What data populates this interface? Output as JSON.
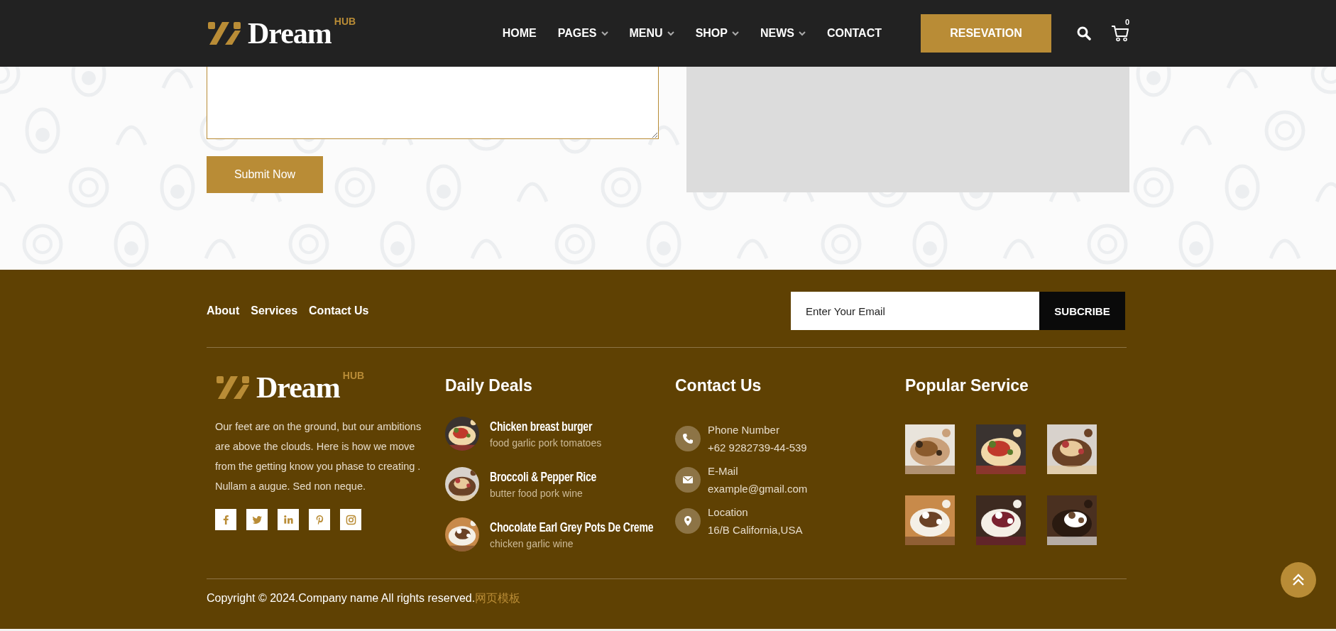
{
  "header": {
    "logo": {
      "word": "Dream",
      "badge": "HUB"
    },
    "nav": [
      {
        "label": "HOME",
        "dropdown": false
      },
      {
        "label": "PAGES",
        "dropdown": true
      },
      {
        "label": "MENU",
        "dropdown": true
      },
      {
        "label": "SHOP",
        "dropdown": true
      },
      {
        "label": "NEWS",
        "dropdown": true
      },
      {
        "label": "CONTACT",
        "dropdown": false
      }
    ],
    "reservation_button": "RESEVATION",
    "cart_count": "0"
  },
  "form": {
    "submit_label": "Submit Now"
  },
  "footer": {
    "links": [
      "About",
      "Services",
      "Contact Us"
    ],
    "newsletter": {
      "placeholder": "Enter Your Email",
      "button": "SUBCRIBE"
    },
    "about": {
      "logo": {
        "word": "Dream",
        "badge": "HUB"
      },
      "text": "Our feet are on the ground, but our ambitions are above the clouds. Here is how we move from the getting know you phase to creating . Nullam a augue. Sed non neque.",
      "social": [
        {
          "kind": "facebook"
        },
        {
          "kind": "twitter"
        },
        {
          "kind": "linkedin"
        },
        {
          "kind": "pinterest"
        },
        {
          "kind": "instagram"
        }
      ]
    },
    "daily_deals": {
      "title": "Daily Deals",
      "items": [
        {
          "kind": "picture",
          "title": "Chicken breast burger",
          "subtitle": "food garlic pork tomatoes"
        },
        {
          "kind": "picture",
          "title": "Broccoli & Pepper Rice",
          "subtitle": "butter food pork wine"
        },
        {
          "kind": "picture",
          "title": "Chocolate Earl Grey Pots De Creme",
          "subtitle": "chicken garlic wine"
        }
      ]
    },
    "contact": {
      "title": "Contact Us",
      "items": [
        {
          "kind": "phone",
          "label": "Phone Number",
          "value": "+62 9282739-44-539"
        },
        {
          "kind": "email",
          "label": "E-Mail",
          "value": "example@gmail.com"
        },
        {
          "kind": "location",
          "label": "Location",
          "value": "16/B California,USA"
        }
      ]
    },
    "popular": {
      "title": "Popular Service"
    },
    "copyright": {
      "text": "Copyright © 2024.Company name All rights reserved.",
      "link": "网页模板"
    }
  }
}
